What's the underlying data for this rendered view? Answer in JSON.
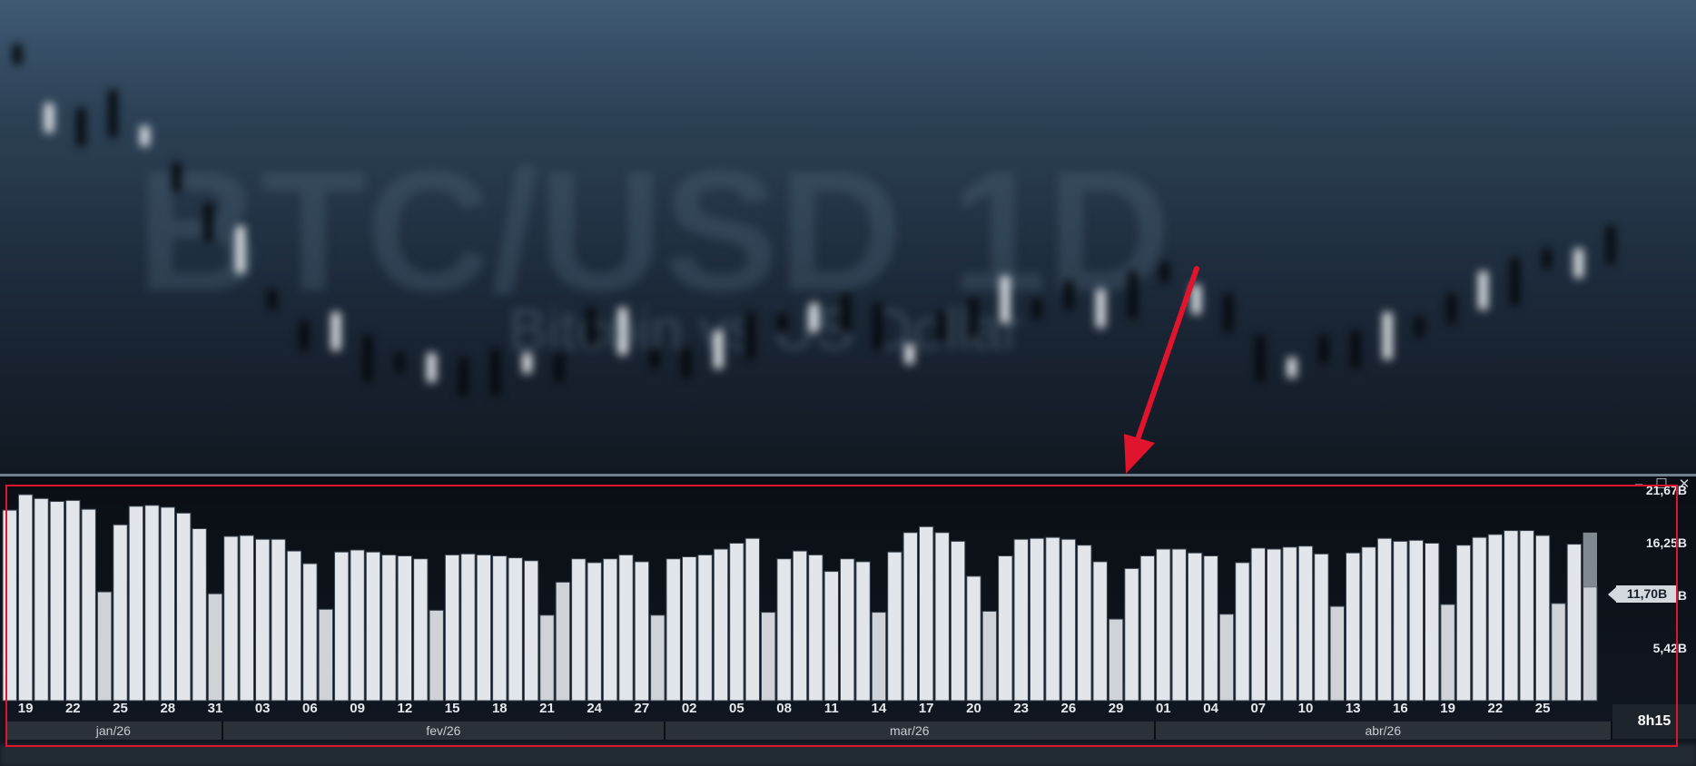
{
  "window": {
    "minimize_icon": "minimize-icon",
    "maximize_icon": "maximize-icon",
    "close_icon": "close-icon"
  },
  "price_panel": {
    "watermark_title": "BTC/USD 1D",
    "watermark_subtitle": "Bitcoin vs US Dollar",
    "colors": {
      "background": "#2d4257",
      "candle_up": "#e8ecf0",
      "candle_down": "#05080c"
    }
  },
  "chart_data": {
    "type": "bar",
    "series": [
      {
        "values": [
          19.6,
          21.2,
          20.8,
          20.5,
          20.6,
          19.7,
          11.2,
          18.1,
          20.0,
          20.1,
          19.9,
          19.3,
          17.7,
          11.0,
          16.9,
          17.0,
          16.6,
          16.6,
          15.4,
          14.1,
          9.4,
          15.3,
          15.5,
          15.3,
          15.0,
          14.9,
          14.6,
          9.3,
          15.0,
          15.1,
          15.0,
          14.9,
          14.7,
          14.4,
          8.8,
          12.2,
          14.6,
          14.2,
          14.6,
          15.0,
          14.3,
          8.8,
          14.6,
          14.8,
          15.0,
          15.6,
          16.2,
          16.7,
          9.1,
          14.6,
          15.4,
          15.0,
          13.3,
          14.6,
          14.3,
          9.1,
          15.3,
          17.3,
          17.9,
          17.3,
          16.4,
          12.8,
          9.2,
          14.9,
          16.6,
          16.7,
          16.8,
          16.6,
          16.0,
          14.3,
          8.4,
          13.6,
          14.9,
          15.6,
          15.6,
          15.2,
          14.9,
          8.9,
          14.2,
          15.7,
          15.6,
          15.8,
          15.9,
          15.1,
          9.7,
          15.2,
          15.8,
          16.7,
          16.4,
          16.5,
          16.2,
          9.9,
          16.0,
          16.8,
          17.1,
          17.5,
          17.5,
          17.0,
          10.0,
          16.1,
          11.7
        ]
      }
    ],
    "x_tick_labels": [
      "19",
      "22",
      "25",
      "28",
      "31",
      "03",
      "06",
      "09",
      "12",
      "15",
      "18",
      "21",
      "24",
      "27",
      "02",
      "05",
      "08",
      "11",
      "14",
      "17",
      "20",
      "23",
      "26",
      "29",
      "01",
      "04",
      "07",
      "10",
      "13",
      "16",
      "19",
      "22",
      "25"
    ],
    "months": [
      "jan/26",
      "fev/26",
      "mar/26",
      "abr/26"
    ],
    "y_tick_labels": [
      "21,67B",
      "16,25B",
      "10,84B",
      "5,42B"
    ],
    "y_tick_values": [
      21.67,
      16.25,
      10.84,
      5.42
    ],
    "ylim": [
      0,
      22.6
    ],
    "current_value_label": "11,70B",
    "current_value": 11.7,
    "time_remaining": "8h15",
    "colors": {
      "bar": "#e2e6ea",
      "bar_alt": "#cfd3d7",
      "bar_edge": "#3a4450",
      "current_bar": "#808890",
      "highlight": "#e0142c"
    }
  }
}
